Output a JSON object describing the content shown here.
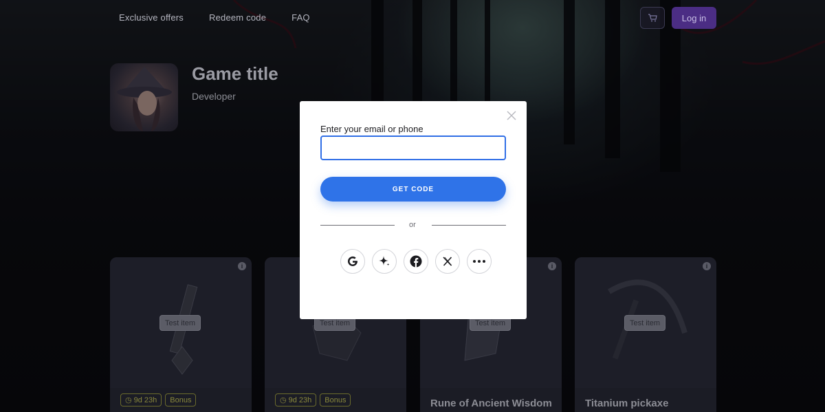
{
  "nav": {
    "items": [
      "Exclusive offers",
      "Redeem code",
      "FAQ"
    ],
    "login_label": "Log in",
    "cart_icon": "cart-icon"
  },
  "game": {
    "title": "Game title",
    "developer": "Developer"
  },
  "cards": [
    {
      "tag": "Test item",
      "chips": [
        "9d 23h",
        "Bonus"
      ],
      "name": ""
    },
    {
      "tag": "Test item",
      "chips": [
        "9d 23h",
        "Bonus"
      ],
      "name": ""
    },
    {
      "tag": "Test item",
      "chips": [],
      "name": "Rune of Ancient Wisdom"
    },
    {
      "tag": "Test item",
      "chips": [],
      "name": "Titanium pickaxe"
    }
  ],
  "modal": {
    "field_label": "Enter your email or phone",
    "field_value": "",
    "get_code_label": "GET CODE",
    "divider_text": "or",
    "social_icons": [
      "google-icon",
      "sparkle-icon",
      "facebook-icon",
      "x-icon",
      "more-icon"
    ]
  },
  "colors": {
    "accent": "#2f73e8",
    "login_bg": "#4b2d84",
    "chip": "#8b8a3c"
  }
}
